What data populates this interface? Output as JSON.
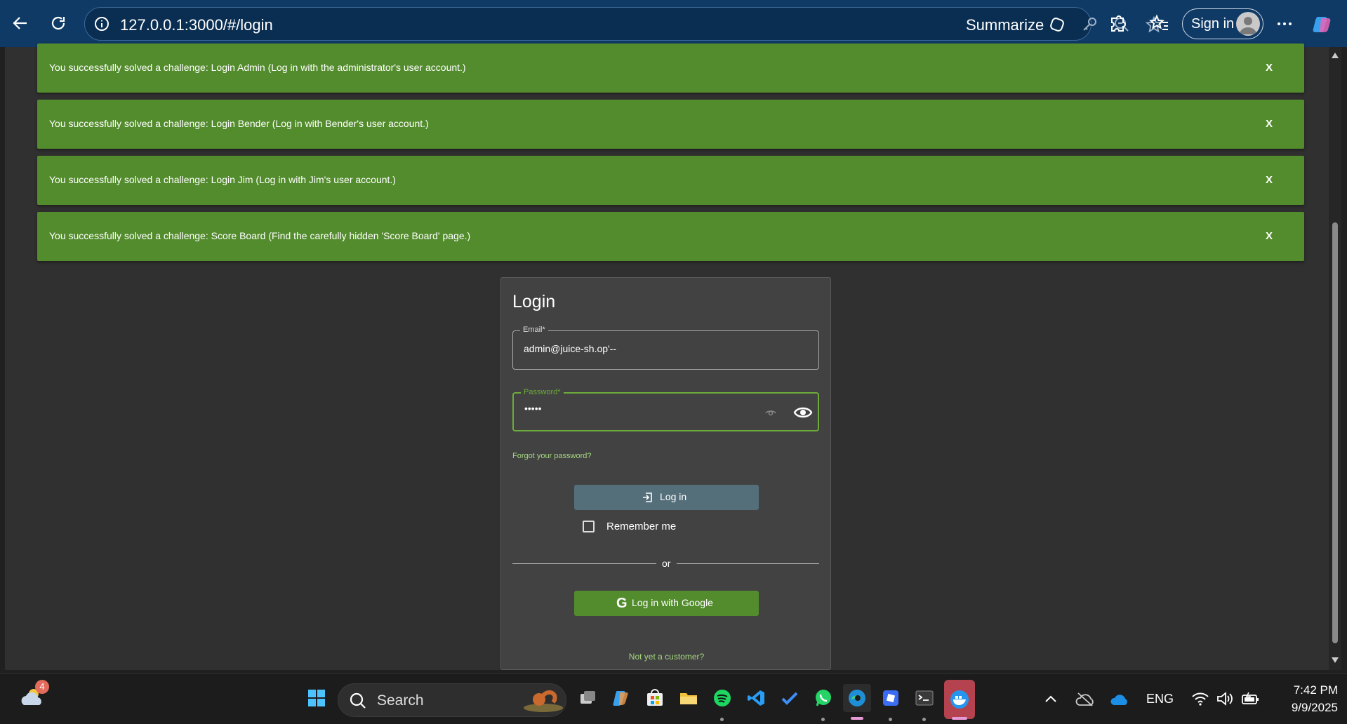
{
  "browser": {
    "url": "127.0.0.1:3000/#/login",
    "summarize_label": "Summarize",
    "signin_label": "Sign in"
  },
  "toasts": [
    {
      "message": "You successfully solved a challenge: Login Admin (Log in with the administrator's user account.)",
      "close": "X"
    },
    {
      "message": "You successfully solved a challenge: Login Bender (Log in with Bender's user account.)",
      "close": "X"
    },
    {
      "message": "You successfully solved a challenge: Login Jim (Log in with Jim's user account.)",
      "close": "X"
    },
    {
      "message": "You successfully solved a challenge: Score Board (Find the carefully hidden 'Score Board' page.)",
      "close": "X"
    }
  ],
  "login": {
    "title": "Login",
    "email_label": "Email*",
    "email_value": "admin@juice-sh.op'--",
    "password_label": "Password*",
    "password_value": "•••••",
    "forgot": "Forgot your password?",
    "login_button": "Log in",
    "remember_me": "Remember me",
    "or": "or",
    "google_button": "Log in with Google",
    "not_customer": "Not yet a customer?"
  },
  "taskbar": {
    "weather_badge": "4",
    "search_label": "Search",
    "language": "ENG",
    "time": "7:42 PM",
    "date": "9/9/2025"
  },
  "colors": {
    "toast_green": "#538c2d",
    "login_button": "#546e7a",
    "accent_green": "#6dab3c",
    "browser_bar": "#0f3a66"
  }
}
